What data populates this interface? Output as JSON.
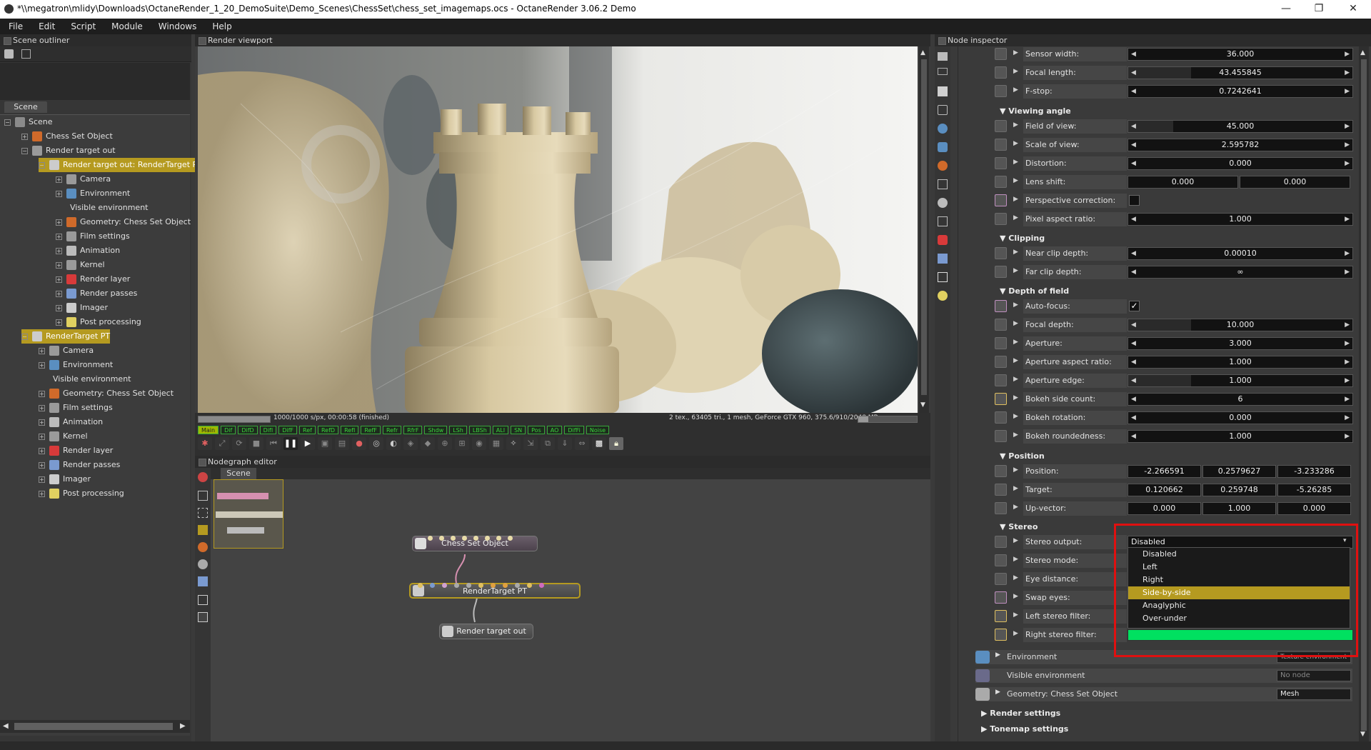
{
  "window": {
    "title": "*\\\\megatron\\mlidy\\Downloads\\OctaneRender_1_20_DemoSuite\\Demo_Scenes\\ChessSet\\chess_set_imagemaps.ocs - OctaneRender 3.06.2 Demo",
    "minimize": "—",
    "maximize": "❐",
    "close": "✕"
  },
  "menu": [
    "File",
    "Edit",
    "Script",
    "Module",
    "Windows",
    "Help"
  ],
  "outliner": {
    "title": "Scene outliner",
    "tab": "Scene",
    "items": [
      {
        "label": "Scene",
        "pm": "−",
        "color": "#8a8a8a"
      },
      {
        "label": "Chess Set Object",
        "pm": "+",
        "color": "#d06a2a"
      },
      {
        "label": "Render target out",
        "pm": "−",
        "color": "#9a9a9a"
      },
      {
        "label": "Render target out: RenderTarget PT",
        "pm": "−",
        "color": "#cccccc"
      },
      {
        "label": "Camera",
        "pm": "+",
        "color": "#9a9a9a"
      },
      {
        "label": "Environment",
        "pm": "+",
        "color": "#5a8ec0"
      },
      {
        "label": "Visible environment",
        "pm": "",
        "color": ""
      },
      {
        "label": "Geometry: Chess Set Object",
        "pm": "+",
        "color": "#d06a2a"
      },
      {
        "label": "Film settings",
        "pm": "+",
        "color": "#9a9a9a"
      },
      {
        "label": "Animation",
        "pm": "+",
        "color": "#bbbbbb"
      },
      {
        "label": "Kernel",
        "pm": "+",
        "color": "#9a9a9a"
      },
      {
        "label": "Render layer",
        "pm": "+",
        "color": "#d83a3a"
      },
      {
        "label": "Render passes",
        "pm": "+",
        "color": "#7a9ad0"
      },
      {
        "label": "Imager",
        "pm": "+",
        "color": "#cccccc"
      },
      {
        "label": "Post processing",
        "pm": "+",
        "color": "#e0d060"
      },
      {
        "label": "RenderTarget PT",
        "pm": "−",
        "color": "#cccccc"
      },
      {
        "label": "Camera",
        "pm": "+",
        "color": "#9a9a9a"
      },
      {
        "label": "Environment",
        "pm": "+",
        "color": "#5a8ec0"
      },
      {
        "label": "Visible environment",
        "pm": "",
        "color": ""
      },
      {
        "label": "Geometry: Chess Set Object",
        "pm": "+",
        "color": "#d06a2a"
      },
      {
        "label": "Film settings",
        "pm": "+",
        "color": "#9a9a9a"
      },
      {
        "label": "Animation",
        "pm": "+",
        "color": "#bbbbbb"
      },
      {
        "label": "Kernel",
        "pm": "+",
        "color": "#9a9a9a"
      },
      {
        "label": "Render layer",
        "pm": "+",
        "color": "#d83a3a"
      },
      {
        "label": "Render passes",
        "pm": "+",
        "color": "#7a9ad0"
      },
      {
        "label": "Imager",
        "pm": "+",
        "color": "#cccccc"
      },
      {
        "label": "Post processing",
        "pm": "+",
        "color": "#e0d060"
      }
    ]
  },
  "viewport": {
    "title": "Render viewport",
    "progress_text": "1000/1000 s/px, 00:00:58 (finished)",
    "progress": 1.0,
    "stats": "2 tex., 63405 tri., 1 mesh, GeForce GTX 960, 375.6/910/2048 MB",
    "passes": [
      "Main",
      "Dif",
      "DifD",
      "DifI",
      "DifF",
      "Ref",
      "RefD",
      "RefI",
      "RefF",
      "Refr",
      "RfrF",
      "Shdw",
      "LSh",
      "LBSh",
      "ALI",
      "SN",
      "Pos",
      "AO",
      "DifFi",
      "Noise"
    ]
  },
  "nodegraph": {
    "title": "Nodegraph editor",
    "tab": "Scene",
    "nodes": {
      "chess": "Chess Set Object",
      "rtpt": "RenderTarget PT",
      "rtout": "Render target out"
    }
  },
  "inspector": {
    "title": "Node inspector",
    "rows_top": [
      {
        "label": "Sensor width:",
        "value": "36.000"
      },
      {
        "label": "Focal length:",
        "value": "43.455845"
      },
      {
        "label": "F-stop:",
        "value": "0.7242641"
      }
    ],
    "sec_viewing": "Viewing angle",
    "rows_viewing": [
      {
        "label": "Field of view:",
        "value": "45.000"
      },
      {
        "label": "Scale of view:",
        "value": "2.595782"
      },
      {
        "label": "Distortion:",
        "value": "0.000"
      }
    ],
    "lens_shift": {
      "label": "Lens shift:",
      "x": "0.000",
      "y": "0.000"
    },
    "perspective": {
      "label": "Perspective correction:"
    },
    "pixel_aspect": {
      "label": "Pixel aspect ratio:",
      "value": "1.000"
    },
    "sec_clipping": "Clipping",
    "rows_clipping": [
      {
        "label": "Near clip depth:",
        "value": "0.00010"
      },
      {
        "label": "Far clip depth:",
        "value": "∞"
      }
    ],
    "sec_dof": "Depth of field",
    "autofocus": {
      "label": "Auto-focus:",
      "check": "✓"
    },
    "rows_dof": [
      {
        "label": "Focal depth:",
        "value": "10.000"
      },
      {
        "label": "Aperture:",
        "value": "3.000"
      },
      {
        "label": "Aperture aspect ratio:",
        "value": "1.000"
      },
      {
        "label": "Aperture edge:",
        "value": "1.000"
      },
      {
        "label": "Bokeh side count:",
        "value": "6"
      },
      {
        "label": "Bokeh rotation:",
        "value": "0.000"
      },
      {
        "label": "Bokeh roundedness:",
        "value": "1.000"
      }
    ],
    "sec_position": "Position",
    "position": {
      "label": "Position:",
      "x": "-2.266591",
      "y": "0.2579627",
      "z": "-3.233286"
    },
    "target": {
      "label": "Target:",
      "x": "0.120662",
      "y": "0.259748",
      "z": "-5.26285"
    },
    "upvector": {
      "label": "Up-vector:",
      "x": "0.000",
      "y": "1.000",
      "z": "0.000"
    },
    "sec_stereo": "Stereo",
    "stereo_output": {
      "label": "Stereo output:",
      "value": "Disabled"
    },
    "stereo_mode": {
      "label": "Stereo mode:"
    },
    "eye_distance": {
      "label": "Eye distance:"
    },
    "swap_eyes": {
      "label": "Swap eyes:"
    },
    "left_filter": {
      "label": "Left stereo filter:"
    },
    "right_filter": {
      "label": "Right stereo filter:",
      "color": "#00e060"
    },
    "dropdown_options": [
      "Disabled",
      "Left",
      "Right",
      "Side-by-side",
      "Anaglyphic",
      "Over-under"
    ],
    "dropdown_highlight": "Side-by-side",
    "environment": {
      "label": "Environment",
      "value": "Texture environment"
    },
    "visible_env": {
      "label": "Visible environment",
      "value": "No node"
    },
    "geometry": {
      "label": "Geometry: Chess Set Object",
      "value": "Mesh"
    },
    "render_settings": "Render settings",
    "tonemap_settings": "Tonemap settings"
  }
}
